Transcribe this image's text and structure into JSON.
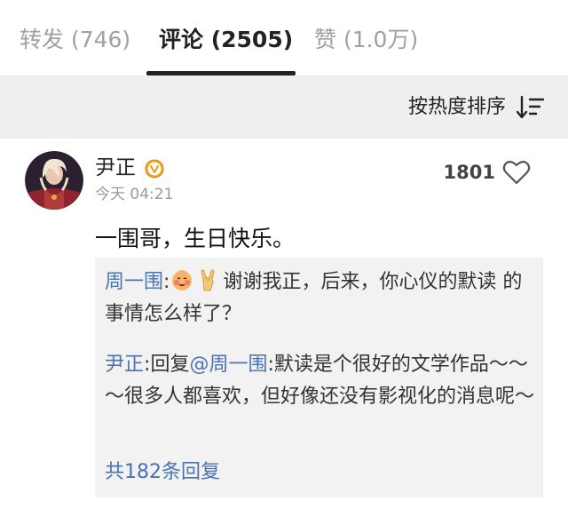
{
  "tabs": {
    "repost": "转发 (746)",
    "comments": "评论 (2505)",
    "likes": "赞 (1.0万)"
  },
  "sort": {
    "label": "按热度排序",
    "icon": "sort-icon"
  },
  "comment": {
    "username": "尹正",
    "timestamp": "今天 04:21",
    "like_count": "1801",
    "text": "一围哥，生日快乐。",
    "replies": [
      {
        "author": "周一围",
        "separator": ":",
        "emojis": [
          "blushing-face-emoji",
          "rock-hand-emoji"
        ],
        "text": "谢谢我正，后来，你心仪的默读 的事情怎么样了？"
      },
      {
        "author": "尹正",
        "separator": ":",
        "reply_word": "回复",
        "mention": "@周一围",
        "text_separator": ":",
        "text": "默读是个很好的文学作品～～～很多人都喜欢，但好像还没有影视化的消息呢～"
      }
    ],
    "total_replies": "共182条回复"
  },
  "colors": {
    "link": "#4a72b2",
    "verified": "#f0a020",
    "sort_bar_bg": "#efefef",
    "reply_bg": "#f2f2f2"
  }
}
